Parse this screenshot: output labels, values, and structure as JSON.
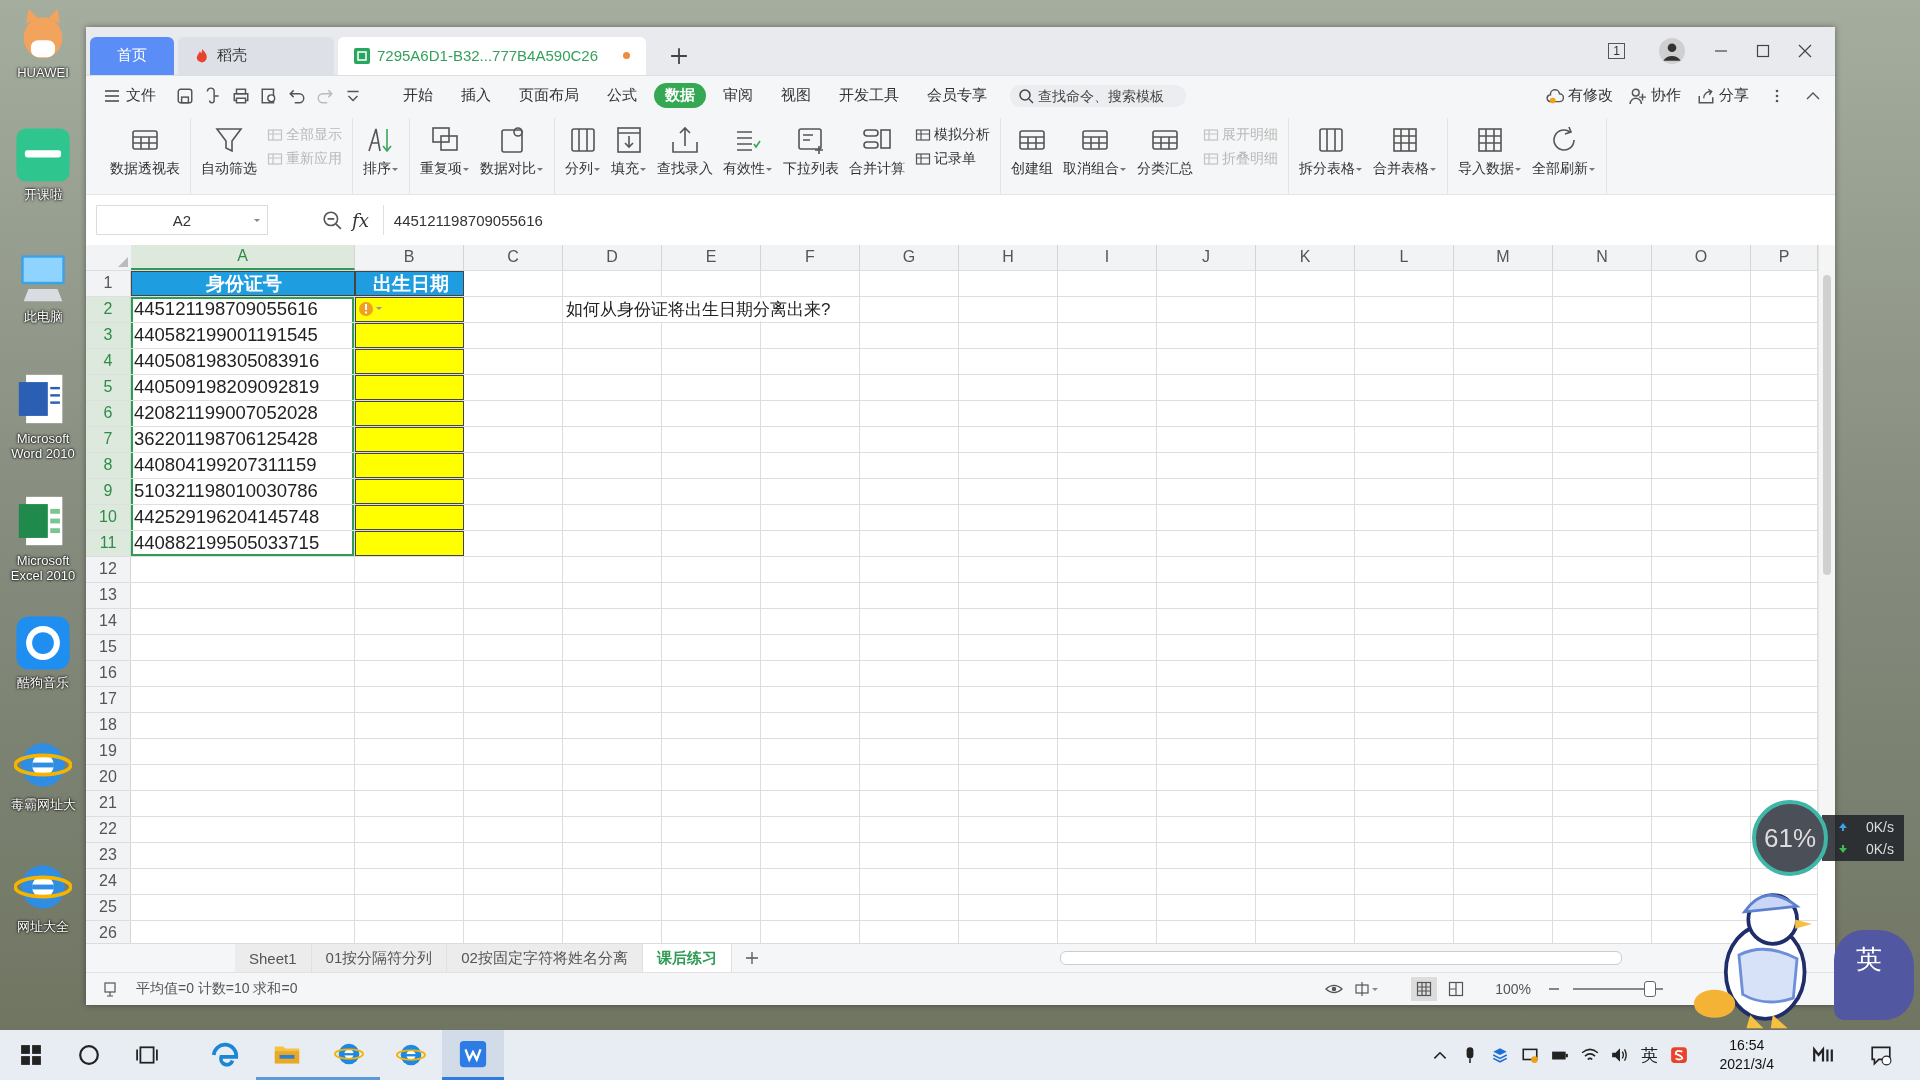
{
  "desktop_icons": [
    {
      "label": "HUAWEI"
    },
    {
      "label": "开课啦"
    },
    {
      "label": "此电脑"
    },
    {
      "label": "Microsoft Word 2010"
    },
    {
      "label": "Microsoft Excel 2010"
    },
    {
      "label": "酷狗音乐"
    },
    {
      "label": "毒霸网址大"
    },
    {
      "label": "网址大全"
    }
  ],
  "window": {
    "tabs": [
      {
        "label": "首页",
        "kind": "home",
        "selected": false,
        "modified": false
      },
      {
        "label": "稻壳",
        "kind": "app",
        "selected": false,
        "modified": false
      },
      {
        "label": "7295A6D1-B32...777B4A590C26",
        "kind": "doc",
        "selected": true,
        "modified": true
      }
    ],
    "window_count": "1",
    "file_menu": "文件",
    "ribbon_tabs": [
      {
        "label": "开始",
        "selected": false
      },
      {
        "label": "插入",
        "selected": false
      },
      {
        "label": "页面布局",
        "selected": false
      },
      {
        "label": "公式",
        "selected": false
      },
      {
        "label": "数据",
        "selected": true
      },
      {
        "label": "审阅",
        "selected": false
      },
      {
        "label": "视图",
        "selected": false
      },
      {
        "label": "开发工具",
        "selected": false
      },
      {
        "label": "会员专享",
        "selected": false
      }
    ],
    "search": {
      "placeholder": "查找命令、搜索模板"
    },
    "actions": [
      {
        "label": "有修改"
      },
      {
        "label": "协作"
      },
      {
        "label": "分享"
      }
    ],
    "ribbon_groups": [
      {
        "items": [
          {
            "kind": "large",
            "label": "数据透视表",
            "dropdown": false
          }
        ]
      },
      {
        "items": [
          {
            "kind": "large",
            "label": "自动筛选",
            "dropdown": false
          },
          {
            "kind": "stack",
            "items": [
              {
                "label": "全部显示",
                "disabled": true
              },
              {
                "label": "重新应用",
                "disabled": true
              }
            ]
          }
        ]
      },
      {
        "items": [
          {
            "kind": "large",
            "label": "排序",
            "dropdown": true
          }
        ]
      },
      {
        "items": [
          {
            "kind": "large",
            "label": "重复项",
            "dropdown": true
          },
          {
            "kind": "large",
            "label": "数据对比",
            "dropdown": true
          }
        ]
      },
      {
        "items": [
          {
            "kind": "large",
            "label": "分列",
            "dropdown": true
          },
          {
            "kind": "large",
            "label": "填充",
            "dropdown": true
          },
          {
            "kind": "large",
            "label": "查找录入",
            "dropdown": false
          },
          {
            "kind": "large",
            "label": "有效性",
            "dropdown": true
          },
          {
            "kind": "large",
            "label": "下拉列表",
            "dropdown": false
          },
          {
            "kind": "large",
            "label": "合并计算",
            "dropdown": false
          },
          {
            "kind": "stack",
            "items": [
              {
                "label": "模拟分析",
                "disabled": false
              },
              {
                "label": "记录单",
                "disabled": false
              }
            ]
          }
        ]
      },
      {
        "items": [
          {
            "kind": "large",
            "label": "创建组",
            "dropdown": false
          },
          {
            "kind": "large",
            "label": "取消组合",
            "dropdown": true
          },
          {
            "kind": "large",
            "label": "分类汇总",
            "dropdown": false
          },
          {
            "kind": "stack",
            "items": [
              {
                "label": "展开明细",
                "disabled": true
              },
              {
                "label": "折叠明细",
                "disabled": true
              }
            ]
          }
        ]
      },
      {
        "items": [
          {
            "kind": "large",
            "label": "拆分表格",
            "dropdown": true
          },
          {
            "kind": "large",
            "label": "合并表格",
            "dropdown": true
          }
        ]
      },
      {
        "items": [
          {
            "kind": "large",
            "label": "导入数据",
            "dropdown": true
          },
          {
            "kind": "large",
            "label": "全部刷新",
            "dropdown": true
          }
        ]
      }
    ],
    "name_box": "A2",
    "fx": "fx",
    "formula": "445121198709055616",
    "columns": [
      {
        "label": "A",
        "selected": true
      },
      {
        "label": "B",
        "selected": false
      },
      {
        "label": "C",
        "selected": false
      },
      {
        "label": "D",
        "selected": false
      },
      {
        "label": "E",
        "selected": false
      },
      {
        "label": "F",
        "selected": false
      },
      {
        "label": "G",
        "selected": false
      },
      {
        "label": "H",
        "selected": false
      },
      {
        "label": "I",
        "selected": false
      },
      {
        "label": "J",
        "selected": false
      },
      {
        "label": "K",
        "selected": false
      },
      {
        "label": "L",
        "selected": false
      },
      {
        "label": "M",
        "selected": false
      },
      {
        "label": "N",
        "selected": false
      },
      {
        "label": "O",
        "selected": false
      },
      {
        "label": "P",
        "selected": false
      }
    ],
    "rows": [
      {
        "number": "1",
        "selected": false,
        "cells": [
          {
            "text": "身份证号",
            "color": "#1e9de0",
            "header": true
          },
          {
            "text": "出生日期",
            "color": "#1e9de0",
            "header": true
          }
        ]
      },
      {
        "number": "2",
        "selected": true,
        "cells": [
          {
            "text": "445121198709055616"
          },
          {
            "color": "#ffff00",
            "warning": true
          }
        ],
        "note": "如何从身份证将出生日期分离出来?"
      },
      {
        "number": "3",
        "selected": true,
        "cells": [
          {
            "text": "440582199001191545"
          },
          {
            "color": "#ffff00"
          }
        ]
      },
      {
        "number": "4",
        "selected": true,
        "cells": [
          {
            "text": "440508198305083916"
          },
          {
            "color": "#ffff00"
          }
        ]
      },
      {
        "number": "5",
        "selected": true,
        "cells": [
          {
            "text": "440509198209092819"
          },
          {
            "color": "#ffff00"
          }
        ]
      },
      {
        "number": "6",
        "selected": true,
        "cells": [
          {
            "text": "420821199007052028"
          },
          {
            "color": "#ffff00"
          }
        ]
      },
      {
        "number": "7",
        "selected": true,
        "cells": [
          {
            "text": "362201198706125428"
          },
          {
            "color": "#ffff00"
          }
        ]
      },
      {
        "number": "8",
        "selected": true,
        "cells": [
          {
            "text": "440804199207311159"
          },
          {
            "color": "#ffff00"
          }
        ]
      },
      {
        "number": "9",
        "selected": true,
        "cells": [
          {
            "text": "510321198010030786"
          },
          {
            "color": "#ffff00"
          }
        ]
      },
      {
        "number": "10",
        "selected": true,
        "cells": [
          {
            "text": "442529196204145748"
          },
          {
            "color": "#ffff00"
          }
        ]
      },
      {
        "number": "11",
        "selected": true,
        "cells": [
          {
            "text": "440882199505033715"
          },
          {
            "color": "#ffff00"
          }
        ]
      },
      {
        "number": "12",
        "selected": false
      },
      {
        "number": "13",
        "selected": false
      },
      {
        "number": "14",
        "selected": false
      },
      {
        "number": "15",
        "selected": false
      },
      {
        "number": "16",
        "selected": false
      },
      {
        "number": "17",
        "selected": false
      },
      {
        "number": "18",
        "selected": false
      },
      {
        "number": "19",
        "selected": false
      },
      {
        "number": "20",
        "selected": false
      },
      {
        "number": "21",
        "selected": false
      },
      {
        "number": "22",
        "selected": false
      },
      {
        "number": "23",
        "selected": false
      },
      {
        "number": "24",
        "selected": false
      },
      {
        "number": "25",
        "selected": false
      },
      {
        "number": "26",
        "selected": false
      }
    ],
    "sheet_tabs": [
      {
        "label": "Sheet1",
        "selected": false
      },
      {
        "label": "01按分隔符分列",
        "selected": false
      },
      {
        "label": "02按固定字符将姓名分离",
        "selected": false
      },
      {
        "label": "课后练习",
        "selected": true
      }
    ],
    "status": "平均值=0 计数=10 求和=0",
    "views": [
      {
        "selected": true
      },
      {
        "selected": false
      }
    ],
    "zoom": "100%",
    "zoom_slider": {
      "level": 0.85
    }
  },
  "monitor": {
    "cpu": "61%",
    "upload": "0K/s",
    "download": "0K/s"
  },
  "ime_badge": "英",
  "taskbar": {
    "apps": [
      {
        "open": false,
        "selected": false
      },
      {
        "open": true,
        "selected": false
      },
      {
        "open": true,
        "selected": false
      },
      {
        "open": false,
        "selected": false
      },
      {
        "open": true,
        "selected": true
      }
    ],
    "ime": "英",
    "time": "16:54",
    "date": "2021/3/4"
  }
}
